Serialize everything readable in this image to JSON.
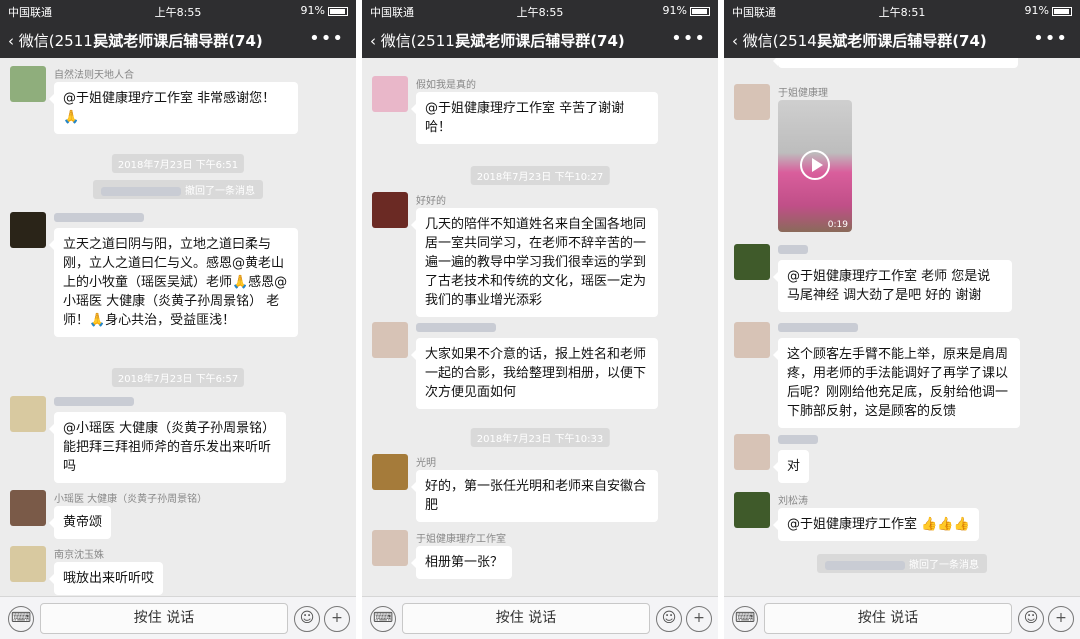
{
  "panels": [
    {
      "status": {
        "carrier": "中国联通",
        "time": "上午8:55",
        "battery": "91%"
      },
      "nav": {
        "back": "微信(2511)",
        "title": "吴斌老师课后辅导群(74)"
      },
      "messages": {
        "m1_sender": "自然法则天地人合",
        "m1_text": "@于姐健康理疗工作室 非常感谢您！🙏",
        "ts1": "2018年7月23日 下午6:51",
        "recall1": "撤回了一条消息",
        "m2_text": "立天之道曰阴与阳，立地之道曰柔与刚，立人之道曰仁与义。感恩@黄老山上的小牧童（瑶医吴斌）老师🙏感恩@小瑶医 大健康（炎黄子孙周景铭） 老师！🙏身心共治，受益匪浅！",
        "ts2": "2018年7月23日 下午6:57",
        "m3_text": "@小瑶医 大健康（炎黄子孙周景铭） 能把拜三拜祖师斧的音乐发出来听听吗",
        "m4_sender": "小瑶医 大健康（炎黄子孙周景铭）",
        "m4_text": "黄帝颂",
        "m5_sender": "南京沈玉姝",
        "m5_text": "哦放出来听听哎"
      },
      "input": {
        "hold": "按住 说话"
      }
    },
    {
      "status": {
        "carrier": "中国联通",
        "time": "上午8:55",
        "battery": "91%"
      },
      "nav": {
        "back": "微信(2511)",
        "title": "吴斌老师课后辅导群(74)"
      },
      "messages": {
        "m1_sender": "假如我是真的",
        "m1_text": "@于姐健康理疗工作室 辛苦了谢谢哈！",
        "ts1": "2018年7月23日 下午10:27",
        "m2_sender": "好好的",
        "m2_text": "几天的陪伴不知道姓名来自全国各地同居一室共同学习，在老师不辞辛苦的一遍一遍的教导中学习我们很幸运的学到了古老技术和传统的文化，瑶医一定为我们的事业增光添彩",
        "m3_text": "大家如果不介意的话，报上姓名和老师一起的合影，我给整理到相册，以便下次方便见面如何",
        "ts2": "2018年7月23日 下午10:33",
        "m4_sender": "光明",
        "m4_text": "好的，第一张任光明和老师来自安徽合肥",
        "m5_sender": "于姐健康理疗工作室",
        "m5_text": "相册第一张？"
      },
      "input": {
        "hold": "按住 说话"
      }
    },
    {
      "status": {
        "carrier": "中国联通",
        "time": "上午8:51",
        "battery": "91%"
      },
      "nav": {
        "back": "微信(2514)",
        "title": "吴斌老师课后辅导群(74)"
      },
      "messages": {
        "m1_sender": "于姐健康理",
        "video_duration": "0:19",
        "m2_text": "@于姐健康理疗工作室 老师 您是说马尾神经 调大劲了是吧 好的 谢谢",
        "m3_text": "这个顾客左手臂不能上举，原来是肩周疼，用老师的手法能调好了再学了课以后呢？刚刚给他充足底，反射给他调一下肺部反射，这是顾客的反馈",
        "m4_text": "对",
        "m5_sender": "刘松涛",
        "m5_text": "@于姐健康理疗工作室 👍👍👍",
        "recall1": "撤回了一条消息"
      },
      "input": {
        "hold": "按住 说话"
      }
    }
  ],
  "colors": {
    "header": "#2e2e30",
    "chat_bg": "#ececec",
    "bubble": "#ffffff",
    "timestamp_bg": "#d9d9d9"
  }
}
